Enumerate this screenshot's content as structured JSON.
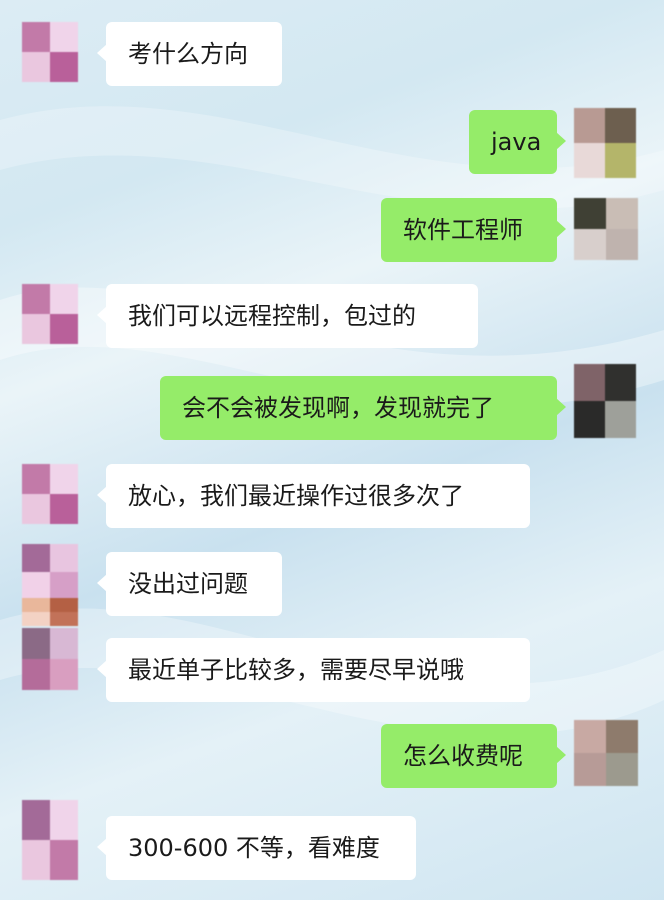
{
  "chat": {
    "messages": [
      {
        "side": "in",
        "text": "考什么方向"
      },
      {
        "side": "out",
        "text": "java"
      },
      {
        "side": "out",
        "text": "软件工程师"
      },
      {
        "side": "in",
        "text": "我们可以远程控制，包过的"
      },
      {
        "side": "out",
        "text": "会不会被发现啊，发现就完了"
      },
      {
        "side": "in",
        "text": "放心，我们最近操作过很多次了"
      },
      {
        "side": "in",
        "text": "没出过问题"
      },
      {
        "side": "in",
        "text": "最近单子比较多，需要尽早说哦"
      },
      {
        "side": "out",
        "text": "怎么收费呢"
      },
      {
        "side": "in",
        "text": "300-600 不等，看难度"
      }
    ]
  },
  "colors": {
    "incoming_bubble": "#ffffff",
    "outgoing_bubble": "#95ec69",
    "text": "#1a1a1a"
  },
  "icons": {
    "incoming_avatar": "pixelated-avatar-icon",
    "outgoing_avatar": "pixelated-avatar-icon"
  }
}
